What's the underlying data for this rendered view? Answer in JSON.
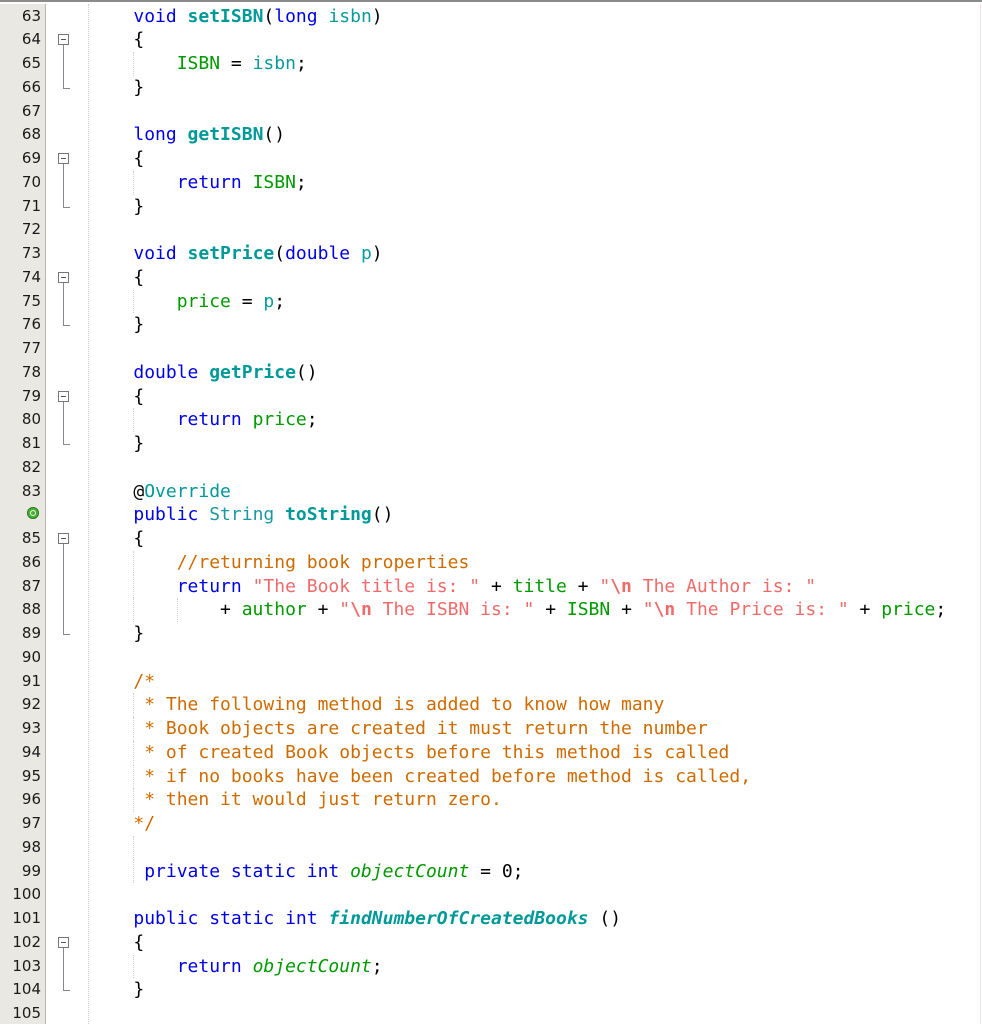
{
  "editor": {
    "language": "java",
    "colors": {
      "keyword": "#0000e6",
      "method": "#009999",
      "field": "#009900",
      "parameter": "#0a9a9a",
      "string": "#f06a6a",
      "comment": "#ce6b00",
      "gutter_bg": "#e9e8e2"
    },
    "lines": [
      {
        "n": "63",
        "fold": "",
        "tokens": [
          [
            "plain",
            "    "
          ],
          [
            "kw",
            "void "
          ],
          [
            "mth",
            "setISBN"
          ],
          [
            "plain",
            "("
          ],
          [
            "kw",
            "long "
          ],
          [
            "par",
            "isbn"
          ],
          [
            "plain",
            ")"
          ]
        ]
      },
      {
        "n": "64",
        "fold": "start",
        "tokens": [
          [
            "plain",
            "    {"
          ]
        ]
      },
      {
        "n": "65",
        "fold": "mid",
        "tokens": [
          [
            "plain",
            "        "
          ],
          [
            "fld",
            "ISBN"
          ],
          [
            "plain",
            " = "
          ],
          [
            "par",
            "isbn"
          ],
          [
            "plain",
            ";"
          ]
        ]
      },
      {
        "n": "66",
        "fold": "end",
        "tokens": [
          [
            "plain",
            "    }"
          ]
        ]
      },
      {
        "n": "67",
        "fold": "",
        "tokens": []
      },
      {
        "n": "68",
        "fold": "",
        "tokens": [
          [
            "plain",
            "    "
          ],
          [
            "kw",
            "long "
          ],
          [
            "mth",
            "getISBN"
          ],
          [
            "plain",
            "()"
          ]
        ]
      },
      {
        "n": "69",
        "fold": "start",
        "tokens": [
          [
            "plain",
            "    {"
          ]
        ]
      },
      {
        "n": "70",
        "fold": "mid",
        "tokens": [
          [
            "plain",
            "        "
          ],
          [
            "kw",
            "return "
          ],
          [
            "fld",
            "ISBN"
          ],
          [
            "plain",
            ";"
          ]
        ]
      },
      {
        "n": "71",
        "fold": "end",
        "tokens": [
          [
            "plain",
            "    }"
          ]
        ]
      },
      {
        "n": "72",
        "fold": "",
        "tokens": []
      },
      {
        "n": "73",
        "fold": "",
        "tokens": [
          [
            "plain",
            "    "
          ],
          [
            "kw",
            "void "
          ],
          [
            "mth",
            "setPrice"
          ],
          [
            "plain",
            "("
          ],
          [
            "kw",
            "double "
          ],
          [
            "par",
            "p"
          ],
          [
            "plain",
            ")"
          ]
        ]
      },
      {
        "n": "74",
        "fold": "start",
        "tokens": [
          [
            "plain",
            "    {"
          ]
        ]
      },
      {
        "n": "75",
        "fold": "mid",
        "tokens": [
          [
            "plain",
            "        "
          ],
          [
            "fld",
            "price"
          ],
          [
            "plain",
            " = "
          ],
          [
            "par",
            "p"
          ],
          [
            "plain",
            ";"
          ]
        ]
      },
      {
        "n": "76",
        "fold": "end",
        "tokens": [
          [
            "plain",
            "    }"
          ]
        ]
      },
      {
        "n": "77",
        "fold": "",
        "tokens": []
      },
      {
        "n": "78",
        "fold": "",
        "tokens": [
          [
            "plain",
            "    "
          ],
          [
            "kw",
            "double "
          ],
          [
            "mth",
            "getPrice"
          ],
          [
            "plain",
            "()"
          ]
        ]
      },
      {
        "n": "79",
        "fold": "start",
        "tokens": [
          [
            "plain",
            "    {"
          ]
        ]
      },
      {
        "n": "80",
        "fold": "mid",
        "tokens": [
          [
            "plain",
            "        "
          ],
          [
            "kw",
            "return "
          ],
          [
            "fld",
            "price"
          ],
          [
            "plain",
            ";"
          ]
        ]
      },
      {
        "n": "81",
        "fold": "end",
        "tokens": [
          [
            "plain",
            "    }"
          ]
        ]
      },
      {
        "n": "82",
        "fold": "",
        "tokens": []
      },
      {
        "n": "83",
        "fold": "",
        "tokens": [
          [
            "plain",
            "    @"
          ],
          [
            "ann",
            "Override"
          ]
        ]
      },
      {
        "n": "",
        "fold": "",
        "icon": "override",
        "tokens": [
          [
            "plain",
            "    "
          ],
          [
            "kw",
            "public "
          ],
          [
            "typ",
            "String "
          ],
          [
            "mth",
            "toString"
          ],
          [
            "plain",
            "()"
          ]
        ]
      },
      {
        "n": "85",
        "fold": "start",
        "tokens": [
          [
            "plain",
            "    {"
          ]
        ]
      },
      {
        "n": "86",
        "fold": "mid",
        "tokens": [
          [
            "plain",
            "        "
          ],
          [
            "cmt",
            "//returning book properties"
          ]
        ]
      },
      {
        "n": "87",
        "fold": "mid",
        "tokens": [
          [
            "plain",
            "        "
          ],
          [
            "kw",
            "return "
          ],
          [
            "str",
            "\"The Book title is: \""
          ],
          [
            "plain",
            " + "
          ],
          [
            "fld",
            "title"
          ],
          [
            "plain",
            " + "
          ],
          [
            "str",
            "\""
          ],
          [
            "esc",
            "\\n"
          ],
          [
            "str",
            " The Author is: \""
          ]
        ]
      },
      {
        "n": "88",
        "fold": "mid",
        "tokens": [
          [
            "plain",
            "            + "
          ],
          [
            "fld",
            "author"
          ],
          [
            "plain",
            " + "
          ],
          [
            "str",
            "\""
          ],
          [
            "esc",
            "\\n"
          ],
          [
            "str",
            " The ISBN is: \""
          ],
          [
            "plain",
            " + "
          ],
          [
            "fld",
            "ISBN"
          ],
          [
            "plain",
            " + "
          ],
          [
            "str",
            "\""
          ],
          [
            "esc",
            "\\n"
          ],
          [
            "str",
            " The Price is: \""
          ],
          [
            "plain",
            " + "
          ],
          [
            "fld",
            "price"
          ],
          [
            "plain",
            ";"
          ]
        ]
      },
      {
        "n": "89",
        "fold": "end",
        "tokens": [
          [
            "plain",
            "    }"
          ]
        ]
      },
      {
        "n": "90",
        "fold": "",
        "tokens": []
      },
      {
        "n": "91",
        "fold": "",
        "tokens": [
          [
            "plain",
            "    "
          ],
          [
            "cmt",
            "/*"
          ]
        ]
      },
      {
        "n": "92",
        "fold": "",
        "tokens": [
          [
            "plain",
            "     "
          ],
          [
            "cmt",
            "* The following method is added to know how many"
          ]
        ]
      },
      {
        "n": "93",
        "fold": "",
        "tokens": [
          [
            "plain",
            "     "
          ],
          [
            "cmt",
            "* Book objects are created it must return the number"
          ]
        ]
      },
      {
        "n": "94",
        "fold": "",
        "tokens": [
          [
            "plain",
            "     "
          ],
          [
            "cmt",
            "* of created Book objects before this method is called"
          ]
        ]
      },
      {
        "n": "95",
        "fold": "",
        "tokens": [
          [
            "plain",
            "     "
          ],
          [
            "cmt",
            "* if no books have been created before method is called,"
          ]
        ]
      },
      {
        "n": "96",
        "fold": "",
        "tokens": [
          [
            "plain",
            "     "
          ],
          [
            "cmt",
            "* then it would just return zero."
          ]
        ]
      },
      {
        "n": "97",
        "fold": "",
        "tokens": [
          [
            "plain",
            "    "
          ],
          [
            "cmt",
            "*/"
          ]
        ]
      },
      {
        "n": "98",
        "fold": "",
        "tokens": []
      },
      {
        "n": "99",
        "fold": "",
        "tokens": [
          [
            "plain",
            "     "
          ],
          [
            "kw",
            "private static int "
          ],
          [
            "fld-i",
            "objectCount"
          ],
          [
            "plain",
            " = 0;"
          ]
        ]
      },
      {
        "n": "100",
        "fold": "",
        "tokens": []
      },
      {
        "n": "101",
        "fold": "",
        "tokens": [
          [
            "plain",
            "    "
          ],
          [
            "kw",
            "public static int "
          ],
          [
            "mth-i",
            "findNumberOfCreatedBooks"
          ],
          [
            "plain",
            " ()"
          ]
        ]
      },
      {
        "n": "102",
        "fold": "start",
        "tokens": [
          [
            "plain",
            "    {"
          ]
        ]
      },
      {
        "n": "103",
        "fold": "mid",
        "tokens": [
          [
            "plain",
            "        "
          ],
          [
            "kw",
            "return "
          ],
          [
            "fld-i",
            "objectCount"
          ],
          [
            "plain",
            ";"
          ]
        ]
      },
      {
        "n": "104",
        "fold": "end",
        "tokens": [
          [
            "plain",
            "    }"
          ]
        ]
      },
      {
        "n": "105",
        "fold": "",
        "tokens": []
      }
    ]
  }
}
